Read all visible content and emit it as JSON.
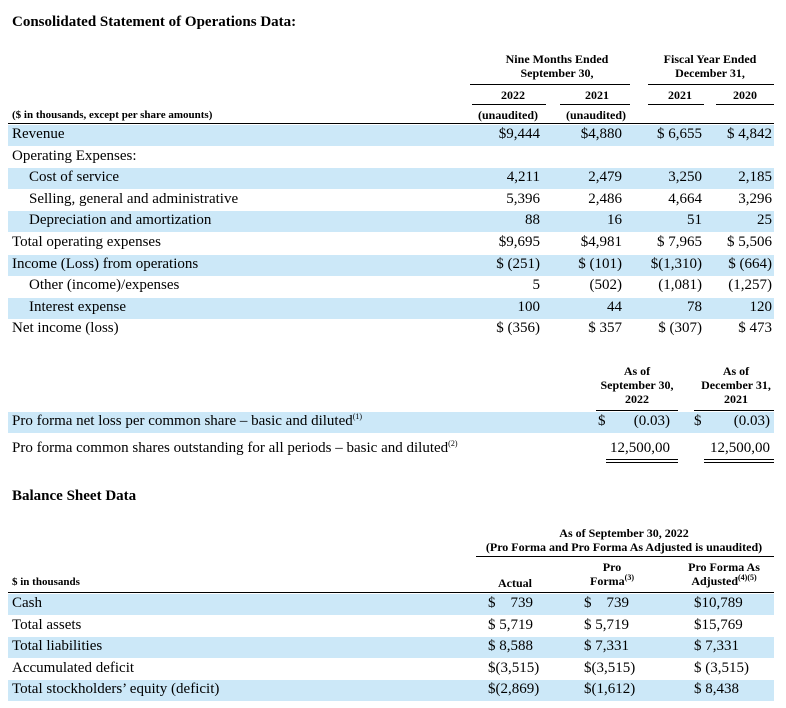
{
  "ops": {
    "title": "Consolidated Statement of Operations Data:",
    "col_group_1": [
      "Nine Months Ended",
      "September 30,"
    ],
    "col_group_2": [
      "Fiscal Year Ended",
      "December 31,"
    ],
    "years": [
      "2022",
      "2021",
      "2021",
      "2020"
    ],
    "unaudited": [
      "(unaudited)",
      "(unaudited)"
    ],
    "units_label": "($ in thousands, except per share amounts)",
    "rows": [
      {
        "label": "Revenue",
        "indent": 0,
        "shade": true,
        "v": [
          "$9,444",
          "$4,880",
          "$ 6,655",
          "$ 4,842"
        ]
      },
      {
        "label": "Operating Expenses:",
        "indent": 0,
        "shade": false,
        "v": [
          "",
          "",
          "",
          ""
        ]
      },
      {
        "label": "Cost of service",
        "indent": 1,
        "shade": true,
        "v": [
          "4,211",
          "2,479",
          "3,250",
          "2,185"
        ]
      },
      {
        "label": "Selling, general and administrative",
        "indent": 1,
        "shade": false,
        "v": [
          "5,396",
          "2,486",
          "4,664",
          "3,296"
        ]
      },
      {
        "label": "Depreciation and amortization",
        "indent": 1,
        "shade": true,
        "v": [
          "88",
          "16",
          "51",
          "25"
        ]
      },
      {
        "label": "Total operating expenses",
        "indent": 0,
        "shade": false,
        "v": [
          "$9,695",
          "$4,981",
          "$ 7,965",
          "$ 5,506"
        ]
      },
      {
        "label": "Income (Loss) from operations",
        "indent": 0,
        "shade": true,
        "v": [
          "$ (251)",
          "$ (101)",
          "$(1,310)",
          "$ (664)"
        ]
      },
      {
        "label": "Other (income)/expenses",
        "indent": 1,
        "shade": false,
        "v": [
          "5",
          "(502)",
          "(1,081)",
          "(1,257)"
        ]
      },
      {
        "label": "Interest expense",
        "indent": 1,
        "shade": true,
        "v": [
          "100",
          "44",
          "78",
          "120"
        ]
      },
      {
        "label": "Net income (loss)",
        "indent": 0,
        "shade": false,
        "v": [
          "$ (356)",
          "$ 357",
          "$ (307)",
          "$ 473"
        ]
      }
    ]
  },
  "pro_forma": {
    "col1": [
      "As of",
      "September 30,",
      "2022"
    ],
    "col2": [
      "As of",
      "December 31,",
      "2021"
    ],
    "rows": [
      {
        "label": "Pro forma net loss per common share – basic and diluted",
        "note": "(1)",
        "shade": true,
        "cur1": "$",
        "v1": "(0.03)",
        "cur2": "$",
        "v2": "(0.03)"
      },
      {
        "label": "Pro forma common shares outstanding for all periods – basic and diluted",
        "note": "(2)",
        "shade": false,
        "cur1": "",
        "v1": "12,500,00",
        "cur2": "",
        "v2": "12,500,00"
      }
    ]
  },
  "balance": {
    "title": "Balance Sheet Data",
    "header_1": "As of September 30, 2022",
    "header_2": "(Pro Forma and Pro Forma As Adjusted is unaudited)",
    "units_label": "$ in thousands",
    "col_actual": "Actual",
    "col_pro_forma": [
      "Pro",
      "Forma"
    ],
    "col_pro_forma_note": "(3)",
    "col_adjusted": [
      "Pro Forma As",
      "Adjusted"
    ],
    "col_adjusted_note": "(4)(5)",
    "rows": [
      {
        "label": "Cash",
        "shade": true,
        "v": [
          "$    739",
          "$    739",
          "$10,789"
        ]
      },
      {
        "label": "Total assets",
        "shade": false,
        "v": [
          "$ 5,719",
          "$ 5,719",
          "$15,769"
        ]
      },
      {
        "label": "Total liabilities",
        "shade": true,
        "v": [
          "$ 8,588",
          "$ 7,331",
          "$ 7,331"
        ]
      },
      {
        "label": "Accumulated deficit",
        "shade": false,
        "v": [
          "$(3,515)",
          "$(3,515)",
          "$ (3,515)"
        ]
      },
      {
        "label": "Total stockholders’ equity (deficit)",
        "shade": true,
        "v": [
          "$(2,869)",
          "$(1,612)",
          "$ 8,438"
        ]
      }
    ]
  }
}
